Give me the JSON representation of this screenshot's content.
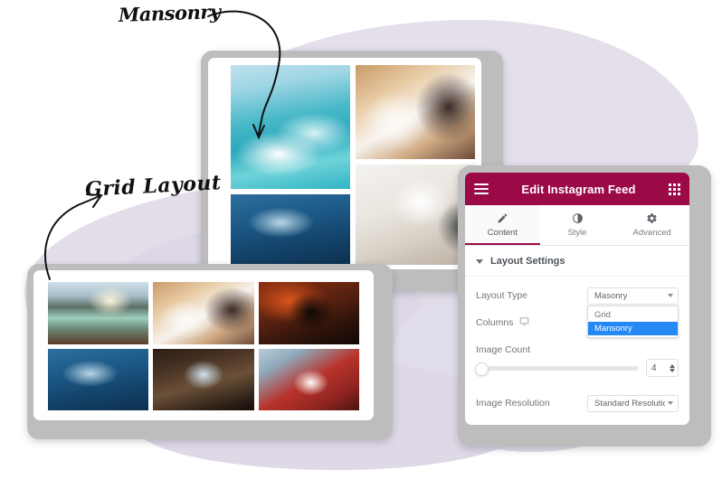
{
  "annotations": {
    "masonry_label": "Mansonry",
    "grid_label": "Grid Layout"
  },
  "panel": {
    "header": {
      "title": "Edit Instagram Feed",
      "menu_icon": "hamburger-icon",
      "apps_icon": "grid-apps-icon",
      "bg_color": "#9B0A46"
    },
    "tabs": [
      {
        "label": "Content",
        "icon": "pencil-icon",
        "active": true
      },
      {
        "label": "Style",
        "icon": "contrast-icon",
        "active": false
      },
      {
        "label": "Advanced",
        "icon": "gear-icon",
        "active": false
      }
    ],
    "section": {
      "title": "Layout Settings",
      "caret_icon": "caret-down-icon",
      "expanded": true
    },
    "fields": {
      "layout_type": {
        "label": "Layout Type",
        "value": "Masonry",
        "dropdown_open": true,
        "options": [
          {
            "label": "Grid",
            "selected": false
          },
          {
            "label": "Mansonry",
            "selected": true
          }
        ],
        "highlight_color": "#2589F5"
      },
      "columns": {
        "label": "Columns",
        "device_icon": "monitor-icon"
      },
      "image_count": {
        "label": "Image Count",
        "value": "4",
        "slider_position_pct": 0,
        "stepper_icon": "stepper-updown-icon"
      },
      "image_resolution": {
        "label": "Image Resolution",
        "value": "Standard Resolutio"
      }
    }
  },
  "previews": {
    "masonry": {
      "columns": [
        [
          {
            "name": "surfers-wave-photo"
          },
          {
            "name": "dolphins-underwater-photo"
          }
        ],
        [
          {
            "name": "pottery-painting-photo"
          },
          {
            "name": "interior-table-photo"
          }
        ]
      ]
    },
    "grid": {
      "cells": [
        {
          "name": "canoe-lake-photo"
        },
        {
          "name": "pottery-painting-photo"
        },
        {
          "name": "red-cave-photo"
        },
        {
          "name": "dolphins-underwater-photo"
        },
        {
          "name": "cave-archway-mountain-photo"
        },
        {
          "name": "camp-mug-photo"
        }
      ]
    }
  },
  "theme": {
    "brush_background": "#E2DDE9",
    "device_frame": "#BDBDBD",
    "accent": "#9B0A46"
  }
}
